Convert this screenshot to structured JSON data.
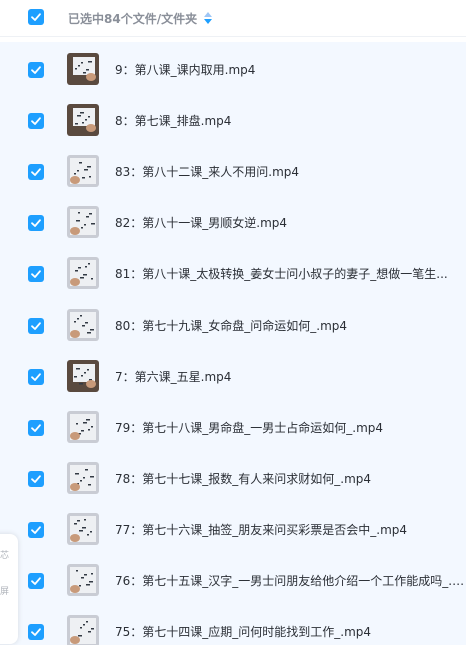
{
  "header": {
    "selection_text": "已选中84个文件/文件夹",
    "sort_icon": "sort-updown-icon"
  },
  "files": [
    {
      "name": "9：第八课_课内取用.mp4",
      "thumb": "dark",
      "checked": true
    },
    {
      "name": "8：第七课_排盘.mp4",
      "thumb": "dark",
      "checked": true
    },
    {
      "name": "83：第八十二课_来人不用问.mp4",
      "thumb": "light",
      "checked": true
    },
    {
      "name": "82：第八十一课_男顺女逆.mp4",
      "thumb": "light",
      "checked": true
    },
    {
      "name": "81：第八十课_太极转换_姜女士问小叔子的妻子_想做一笔生...",
      "thumb": "light",
      "checked": true
    },
    {
      "name": "80：第七十九课_女命盘_问命运如何_.mp4",
      "thumb": "light",
      "checked": true
    },
    {
      "name": "7：第六课_五星.mp4",
      "thumb": "dark",
      "checked": true
    },
    {
      "name": "79：第七十八课_男命盘_一男士占命运如何_.mp4",
      "thumb": "light",
      "checked": true
    },
    {
      "name": "78：第七十七课_报数_有人来问求财如何_.mp4",
      "thumb": "light",
      "checked": true
    },
    {
      "name": "77：第七十六课_抽签_朋友来问买彩票是否会中_.mp4",
      "thumb": "light",
      "checked": true
    },
    {
      "name": "76：第七十五课_汉字_一男士问朋友给他介绍一个工作能成吗_.mp",
      "thumb": "light",
      "checked": true
    },
    {
      "name": "75：第七十四课_应期_问何时能找到工作_.mp4",
      "thumb": "light",
      "checked": true
    }
  ],
  "side_panel": {
    "chars": [
      "芯",
      "屏"
    ]
  },
  "colors": {
    "accent": "#1e9fff",
    "list_bg": "#f3f8ff"
  }
}
